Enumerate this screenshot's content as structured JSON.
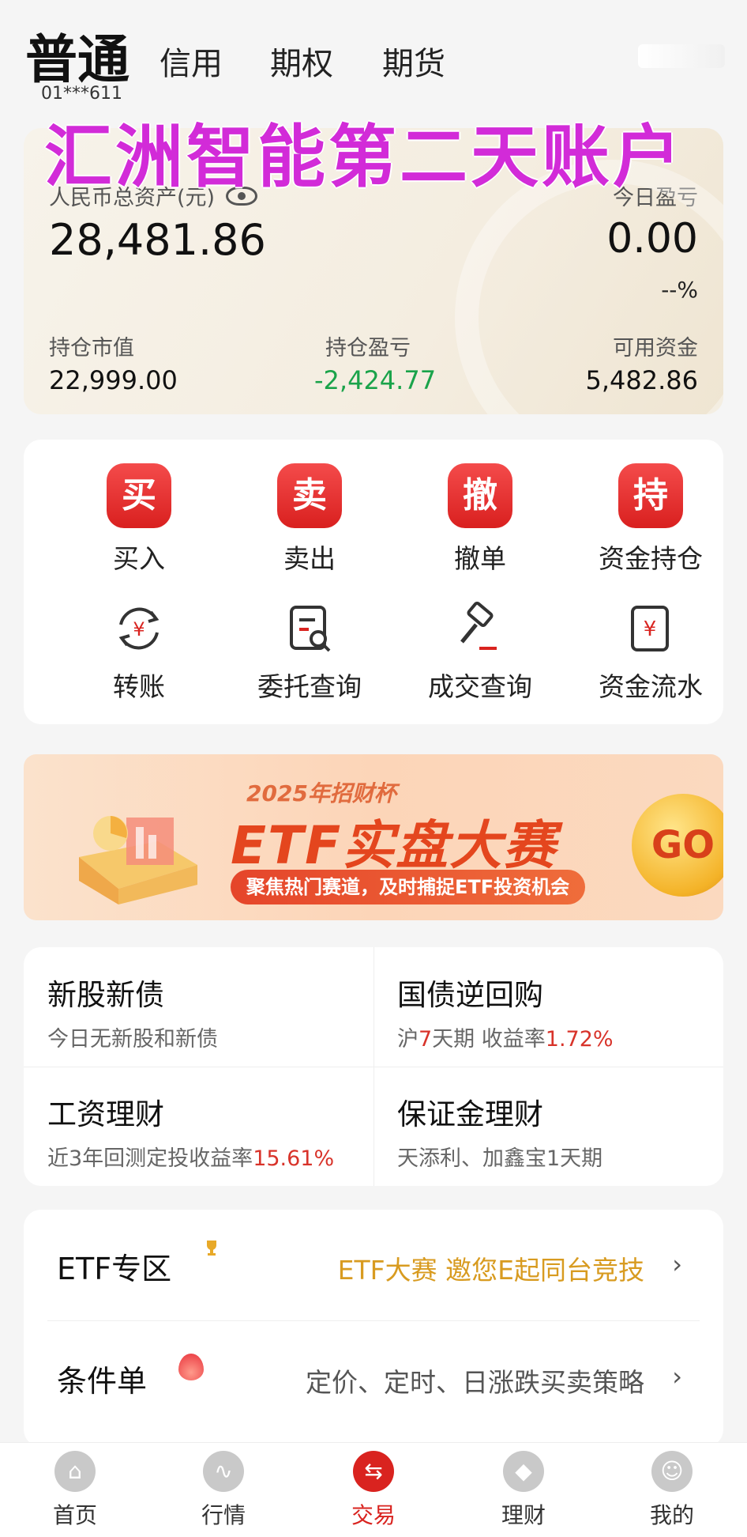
{
  "tabs": {
    "active": "普通",
    "credit": "信用",
    "options": "期权",
    "futures": "期货"
  },
  "account_id": "01***611",
  "overlay_title": "汇洲智能第二天账户",
  "assets": {
    "total_label": "人民币总资产(元)",
    "total_value": "28,481.86",
    "today_label": "今日盈亏",
    "today_value": "0.00",
    "today_pct": "--%",
    "market_value_label": "持仓市值",
    "market_value": "22,999.00",
    "position_pl_label": "持仓盈亏",
    "position_pl": "-2,424.77",
    "available_label": "可用资金",
    "available": "5,482.86",
    "colors": {
      "loss": "#1aa34a"
    }
  },
  "actions": [
    {
      "badge": "买",
      "label": "买入"
    },
    {
      "badge": "卖",
      "label": "卖出"
    },
    {
      "badge": "撤",
      "label": "撤单"
    },
    {
      "badge": "持",
      "label": "资金持仓"
    },
    {
      "icon": "transfer-icon",
      "label": "转账"
    },
    {
      "icon": "order-query-icon",
      "label": "委托查询"
    },
    {
      "icon": "hammer-icon",
      "label": "成交查询"
    },
    {
      "icon": "fund-flow-icon",
      "label": "资金流水"
    }
  ],
  "banner": {
    "year_text": "2025年招财杯",
    "title": "ETF实盘大赛",
    "subtitle": "聚焦热门赛道，及时捕捉ETF投资机会",
    "go": "GO"
  },
  "services": [
    {
      "title": "新股新债",
      "sub": "今日无新股和新债"
    },
    {
      "title": "国债逆回购",
      "sub_prefix": "沪",
      "sub_red1": "7",
      "sub_mid": "天期 收益率",
      "sub_red2": "1.72%"
    },
    {
      "title": "工资理财",
      "sub_prefix": "近3年回测定投收益率",
      "sub_red": "15.61%"
    },
    {
      "title": "保证金理财",
      "sub": "天添利、加鑫宝1天期"
    }
  ],
  "list": [
    {
      "title": "ETF专区",
      "desc": "ETF大赛 邀您E起同台竞技",
      "icon": "trophy-icon"
    },
    {
      "title": "条件单",
      "desc": "定价、定时、日涨跌买卖策略",
      "icon": "flame-icon"
    }
  ],
  "bottom_nav": [
    {
      "label": "首页",
      "icon": "home-icon"
    },
    {
      "label": "行情",
      "icon": "market-icon"
    },
    {
      "label": "交易",
      "icon": "trade-icon",
      "active": true
    },
    {
      "label": "理财",
      "icon": "wealth-icon"
    },
    {
      "label": "我的",
      "icon": "profile-icon"
    }
  ]
}
